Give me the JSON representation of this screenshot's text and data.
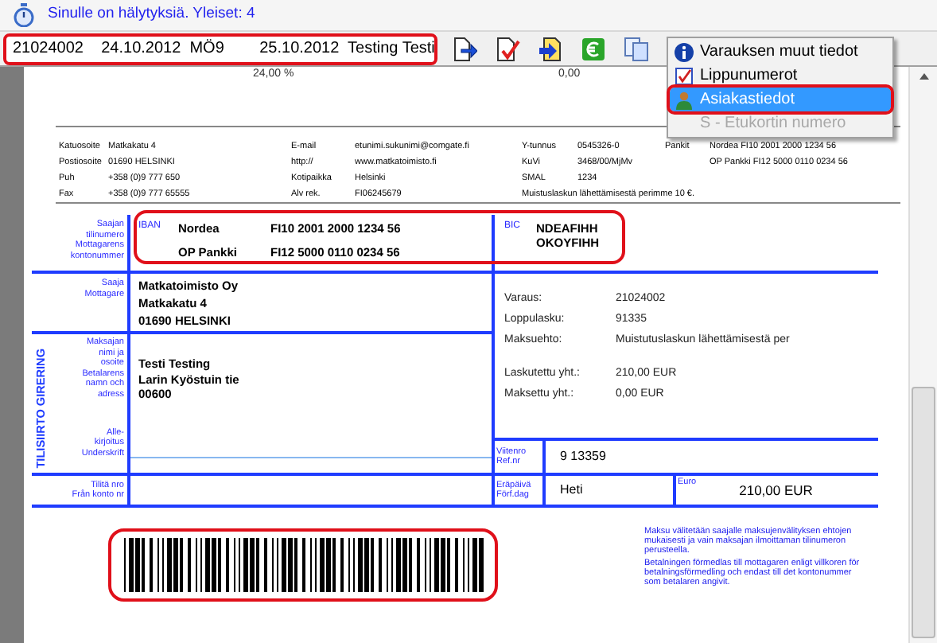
{
  "alert_bar": {
    "text": "Sinulle on hälytyksiä. Yleiset: 4"
  },
  "toolbar": {
    "booking_select": {
      "value": "21024002    24.10.2012  MÖ9        25.10.2012  Testing Testi",
      "highlighted": true
    }
  },
  "menu": {
    "items": [
      {
        "label": "Varauksen muut tiedot",
        "kind": "info",
        "selected": false,
        "disabled": false,
        "highlighted": false
      },
      {
        "label": "Lippunumerot",
        "kind": "checklist",
        "selected": false,
        "disabled": false,
        "highlighted": false
      },
      {
        "label": "Asiakastiedot",
        "kind": "person",
        "selected": true,
        "disabled": false,
        "highlighted": true
      },
      {
        "label": "S - Etukortin numero",
        "kind": "plain",
        "selected": false,
        "disabled": true,
        "highlighted": false
      }
    ]
  },
  "document": {
    "top_values": [
      "24,00 %",
      "0,00"
    ],
    "company_info": [
      [
        {
          "label": "Katuosoite",
          "value": "Matkakatu 4"
        },
        {
          "label": "E-mail",
          "value": "etunimi.sukunimi@comgate.fi"
        },
        {
          "label": "Y-tunnus",
          "value": "0545326-0"
        },
        {
          "label": "Pankit",
          "value": "Nordea FI10 2001 2000 1234 56"
        }
      ],
      [
        {
          "label": "Postiosoite",
          "value": "01690 HELSINKI"
        },
        {
          "label": "http://",
          "value": "www.matkatoimisto.fi"
        },
        {
          "label": "KuVi",
          "value": "3468/00/MjMv"
        },
        {
          "value": "OP Pankki FI12 5000 0110 0234 56"
        }
      ],
      [
        {
          "label": "Puh",
          "value": "+358 (0)9  777 650"
        },
        {
          "label": "Kotipaikka",
          "value": "Helsinki"
        },
        {
          "label": "SMAL",
          "value": "1234"
        }
      ],
      [
        {
          "label": "Fax",
          "value": "+358 (0)9  777 65555"
        },
        {
          "label": "Alv rek.",
          "value": "FI06245679"
        },
        {
          "note": "Muistuslaskun lähettämisestä perimme 10 €."
        }
      ]
    ],
    "giro": {
      "recipient_account": {
        "label": "Saajan\ntilinumero\nMottagarens\nkontonummer",
        "iban_label": "IBAN",
        "accounts": [
          {
            "bank": "Nordea",
            "iban": "FI10 2001 2000 1234 56"
          },
          {
            "bank": "OP Pankki",
            "iban": "FI12 5000 0110 0234 56"
          }
        ],
        "bic_label": "BIC",
        "bics": [
          "NDEAFIHH",
          "OKOYFIHH"
        ],
        "highlighted": true
      },
      "recipient": {
        "label": "Saaja\nMottagare",
        "lines": [
          "Matkatoimisto Oy",
          "Matkakatu 4",
          "01690 HELSINKI"
        ]
      },
      "side_title": "TILISIIRTO GIRERING",
      "payer": {
        "label": "Maksajan\nnimi ja\nosoite\nBetalarens\nnamn och\nadress",
        "lines": [
          "Testi Testing",
          "Larin Kyöstuin tie",
          "00600"
        ]
      },
      "signature": {
        "label": "Alle-\nkirjoitus\nUnderskrift"
      },
      "details": [
        {
          "label": "Varaus:",
          "value": "21024002"
        },
        {
          "label": "Loppulasku:",
          "value": "91335"
        },
        {
          "label": "Maksuehto:",
          "value": "Muistutuslaskun lähettämisestä per"
        }
      ],
      "totals": [
        {
          "label": "Laskutettu yht.:",
          "value": "210,00 EUR"
        },
        {
          "label": "Maksettu yht.:",
          "value": "0,00 EUR"
        }
      ],
      "reference": {
        "label": "Viitenro\nRef.nr",
        "value": "9 13359"
      },
      "from_account": {
        "label": "Tilitä nro\nFrån konto nr"
      },
      "due_date": {
        "label": "Eräpäivä\nFörf.dag",
        "value": "Heti"
      },
      "amount": {
        "label": "Euro",
        "value": "210,00 EUR"
      }
    },
    "barcode": {
      "highlighted": true
    },
    "fine_print": [
      "Maksu välitetään saajalle maksujenvälityksen ehtojen mukaisesti ja vain maksajan ilmoittaman tilinumeron perusteella.",
      "Betalningen förmedlas till mottagaren enligt villkoren för betalningsförmedling och endast till det kontonummer som betalaren angivit."
    ]
  }
}
